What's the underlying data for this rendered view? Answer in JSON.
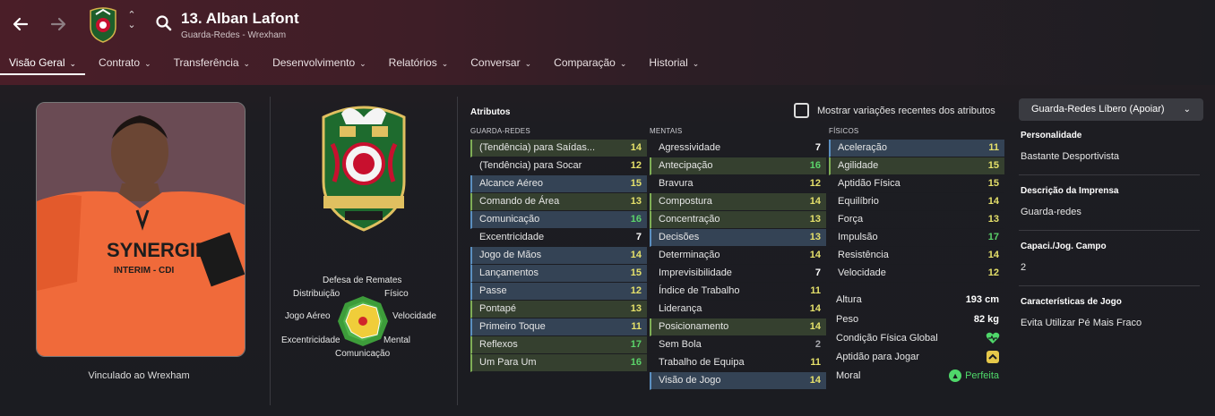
{
  "header": {
    "player_name": "13. Alban Lafont",
    "subtitle": "Guarda-Redes - Wrexham",
    "back_icon": "arrow-left-icon",
    "forward_icon": "arrow-right-icon"
  },
  "tabs": [
    {
      "label": "Visão Geral"
    },
    {
      "label": "Contrato"
    },
    {
      "label": "Transferência"
    },
    {
      "label": "Desenvolvimento"
    },
    {
      "label": "Relatórios"
    },
    {
      "label": "Conversar"
    },
    {
      "label": "Comparação"
    },
    {
      "label": "Historial"
    }
  ],
  "left": {
    "contract_text": "Vinculado ao Wrexham",
    "photo_shirt_text": "SYNERGIE",
    "photo_shirt_sub": "INTERIM - CDI"
  },
  "radar": {
    "labels": {
      "top": "Defesa de Remates",
      "top_left": "Distribuição",
      "top_right": "Físico",
      "left": "Jogo Aéreo",
      "right": "Velocidade",
      "bottom_left": "Excentricidade",
      "bottom_right": "Mental",
      "bottom": "Comunicação"
    }
  },
  "attributes": {
    "title": "Atributos",
    "show_variations_label": "Mostrar variações recentes dos atributos",
    "role_dropdown": "Guarda-Redes Líbero (Apoiar)",
    "goalkeeping_head": "GUARDA-REDES",
    "mental_head": "MENTAIS",
    "physical_head": "FÍSICOS",
    "goalkeeping": [
      {
        "name": "(Tendência) para Saídas...",
        "value": "14",
        "hl": "g",
        "c": "c-y"
      },
      {
        "name": "(Tendência) para Socar",
        "value": "12",
        "hl": "n",
        "c": "c-y"
      },
      {
        "name": "Alcance Aéreo",
        "value": "15",
        "hl": "b",
        "c": "c-y"
      },
      {
        "name": "Comando de Área",
        "value": "13",
        "hl": "g",
        "c": "c-y"
      },
      {
        "name": "Comunicação",
        "value": "16",
        "hl": "b",
        "c": "c-g"
      },
      {
        "name": "Excentricidade",
        "value": "7",
        "hl": "n",
        "c": "c-w"
      },
      {
        "name": "Jogo de Mãos",
        "value": "14",
        "hl": "b",
        "c": "c-y"
      },
      {
        "name": "Lançamentos",
        "value": "15",
        "hl": "b",
        "c": "c-y"
      },
      {
        "name": "Passe",
        "value": "12",
        "hl": "b",
        "c": "c-y"
      },
      {
        "name": "Pontapé",
        "value": "13",
        "hl": "g",
        "c": "c-y"
      },
      {
        "name": "Primeiro Toque",
        "value": "11",
        "hl": "b",
        "c": "c-y"
      },
      {
        "name": "Reflexos",
        "value": "17",
        "hl": "g",
        "c": "c-g"
      },
      {
        "name": "Um Para Um",
        "value": "16",
        "hl": "g",
        "c": "c-g"
      }
    ],
    "mental": [
      {
        "name": "Agressividade",
        "value": "7",
        "hl": "n",
        "c": "c-w"
      },
      {
        "name": "Antecipação",
        "value": "16",
        "hl": "g",
        "c": "c-g"
      },
      {
        "name": "Bravura",
        "value": "12",
        "hl": "n",
        "c": "c-y"
      },
      {
        "name": "Compostura",
        "value": "14",
        "hl": "g",
        "c": "c-y"
      },
      {
        "name": "Concentração",
        "value": "13",
        "hl": "g",
        "c": "c-y"
      },
      {
        "name": "Decisões",
        "value": "13",
        "hl": "b",
        "c": "c-y"
      },
      {
        "name": "Determinação",
        "value": "14",
        "hl": "n",
        "c": "c-y"
      },
      {
        "name": "Imprevisibilidade",
        "value": "7",
        "hl": "n",
        "c": "c-w"
      },
      {
        "name": "Índice de Trabalho",
        "value": "11",
        "hl": "n",
        "c": "c-y"
      },
      {
        "name": "Liderança",
        "value": "14",
        "hl": "n",
        "c": "c-y"
      },
      {
        "name": "Posicionamento",
        "value": "14",
        "hl": "g",
        "c": "c-y"
      },
      {
        "name": "Sem Bola",
        "value": "2",
        "hl": "n",
        "c": "c-gray"
      },
      {
        "name": "Trabalho de Equipa",
        "value": "11",
        "hl": "n",
        "c": "c-y"
      },
      {
        "name": "Visão de Jogo",
        "value": "14",
        "hl": "b",
        "c": "c-y"
      }
    ],
    "physical": [
      {
        "name": "Aceleração",
        "value": "11",
        "hl": "b",
        "c": "c-y"
      },
      {
        "name": "Agilidade",
        "value": "15",
        "hl": "g",
        "c": "c-y"
      },
      {
        "name": "Aptidão Física",
        "value": "15",
        "hl": "n",
        "c": "c-y"
      },
      {
        "name": "Equilíbrio",
        "value": "14",
        "hl": "n",
        "c": "c-y"
      },
      {
        "name": "Força",
        "value": "13",
        "hl": "n",
        "c": "c-y"
      },
      {
        "name": "Impulsão",
        "value": "17",
        "hl": "n",
        "c": "c-g"
      },
      {
        "name": "Resistência",
        "value": "14",
        "hl": "n",
        "c": "c-y"
      },
      {
        "name": "Velocidade",
        "value": "12",
        "hl": "n",
        "c": "c-y"
      }
    ],
    "extra": {
      "height_label": "Altura",
      "height_value": "193 cm",
      "weight_label": "Peso",
      "weight_value": "82 kg",
      "condition_label": "Condição Física Global",
      "fitness_label": "Aptidão para Jogar",
      "morale_label": "Moral",
      "morale_value": "Perfeita",
      "condition_icon": "heart-icon",
      "fitness_icon": "chevron-up-icon"
    }
  },
  "info": {
    "personality_head": "Personalidade",
    "personality_value": "Bastante Desportivista",
    "press_head": "Descrição da Imprensa",
    "press_value": "Guarda-redes",
    "ability_head": "Capaci./Jog. Campo",
    "ability_value": "2",
    "traits_head": "Características de Jogo",
    "traits_value": "Evita Utilizar Pé Mais Fraco"
  },
  "colors": {
    "blue_hl": "#344355",
    "green_hl": "#35402f",
    "yellow": "#e5e06a",
    "green": "#5bd36a"
  }
}
